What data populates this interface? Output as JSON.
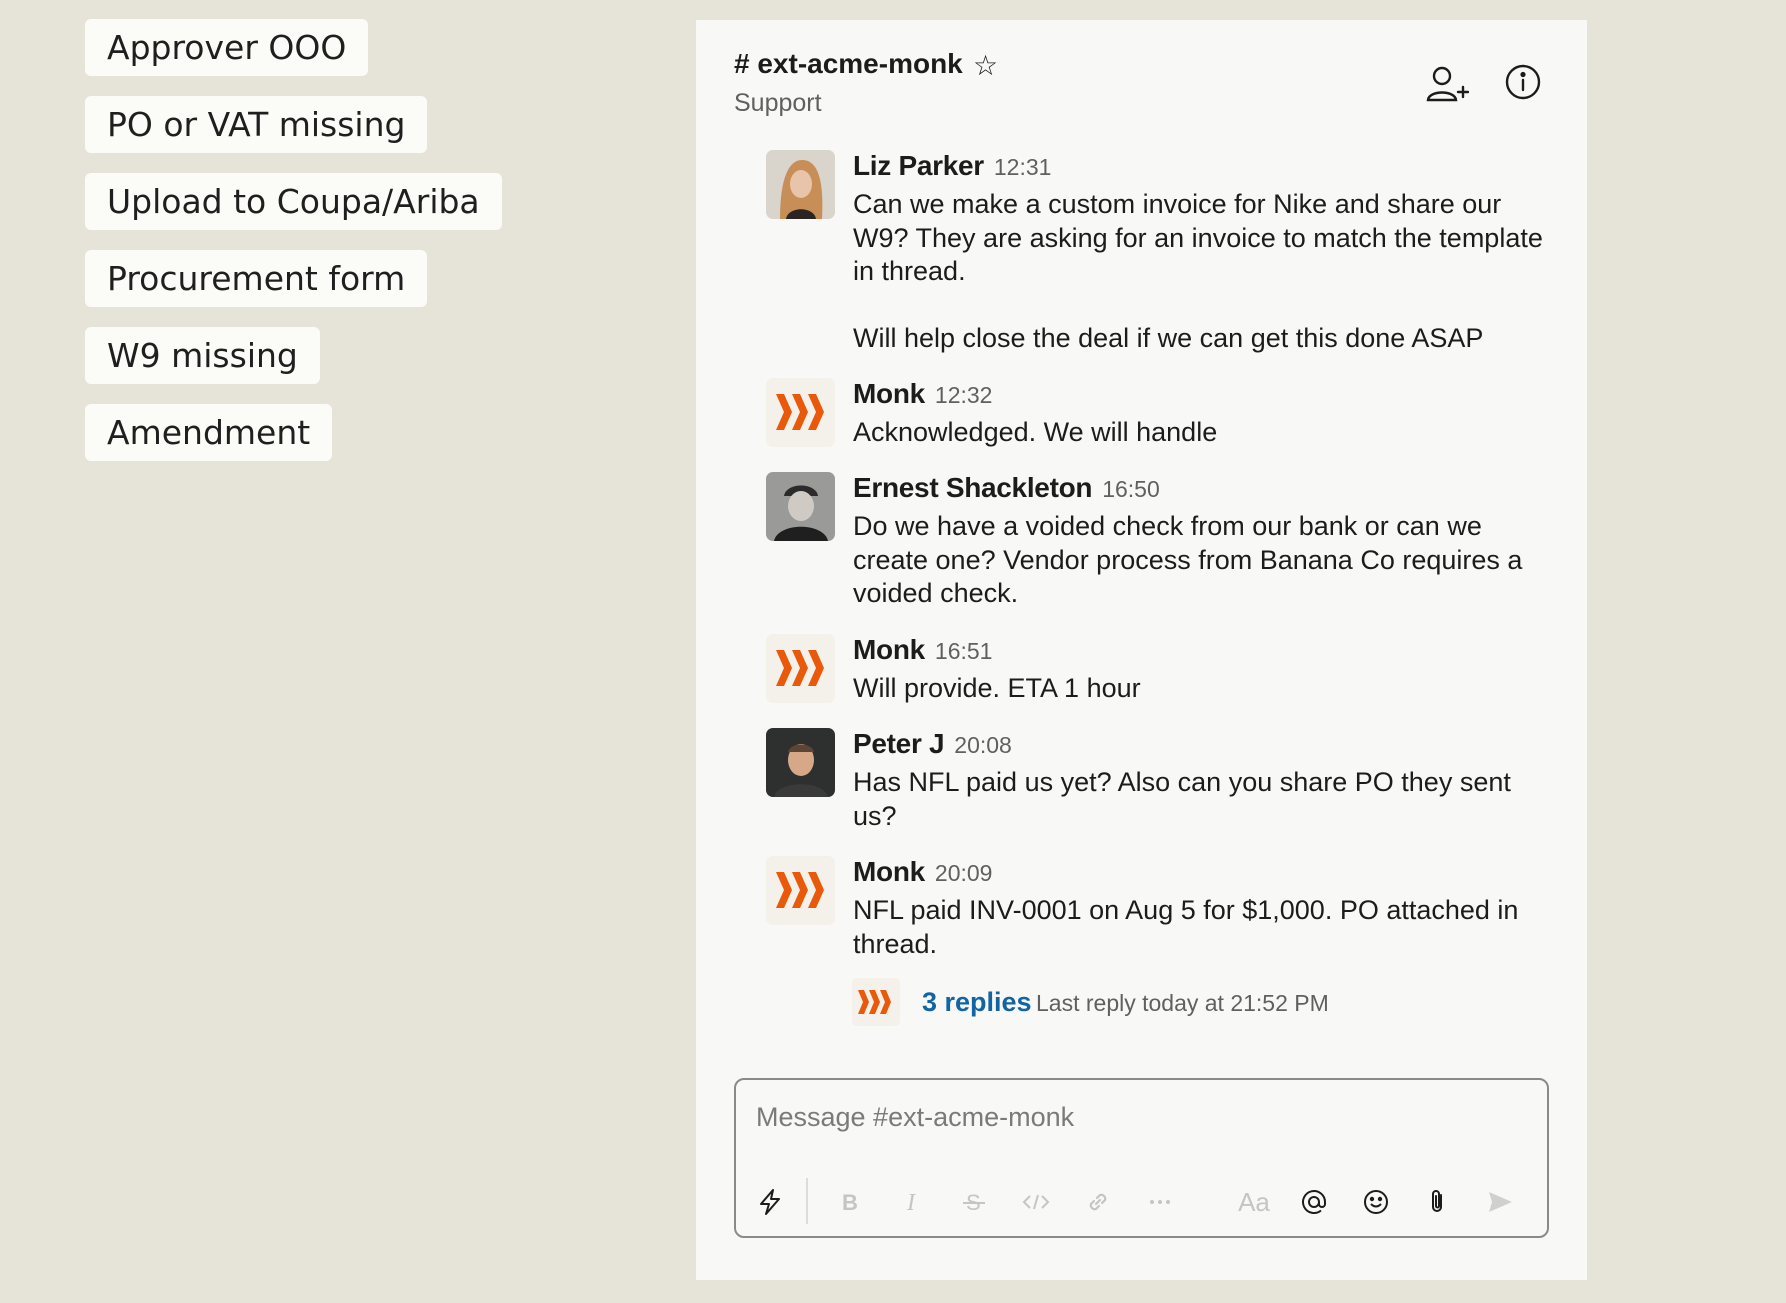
{
  "tags": [
    "Approver OOO",
    "PO or VAT missing",
    "Upload to Coupa/Ariba",
    "Procurement form",
    "W9 missing",
    "Amendment"
  ],
  "channel": {
    "name": "# ext-acme-monk",
    "topic": "Support"
  },
  "messages": [
    {
      "author": "Liz Parker",
      "time": "12:31",
      "text": "Can we make a custom invoice for Nike and share our W9? They are asking for an invoice to match the template in thread.\n\nWill help close the deal if we can get this done ASAP",
      "avatar": "woman-portrait"
    },
    {
      "author": "Monk",
      "time": "12:32",
      "text": "Acknowledged. We will handle",
      "avatar": "monk-logo"
    },
    {
      "author": "Ernest Shackleton",
      "time": "16:50",
      "text": "Do we have a voided check from our bank or can we create one? Vendor process from Banana Co requires a voided check.",
      "avatar": "man-bw-portrait"
    },
    {
      "author": "Monk",
      "time": "16:51",
      "text": "Will provide. ETA 1 hour",
      "avatar": "monk-logo"
    },
    {
      "author": "Peter  J",
      "time": "20:08",
      "text": "Has NFL paid us yet? Also can you share PO they sent us?",
      "avatar": "man-portrait"
    },
    {
      "author": "Monk",
      "time": "20:09",
      "text": "NFL paid INV-0001 on Aug 5 for $1,000. PO attached in thread.",
      "avatar": "monk-logo"
    }
  ],
  "thread": {
    "replies": "3 replies",
    "last_reply": "Last reply today at 21:52 PM"
  },
  "composer": {
    "placeholder": "Message #ext-acme-monk",
    "aa_label": "Aa"
  },
  "colors": {
    "background": "#e6e3d9",
    "panel": "#f8f8f6",
    "monk_orange": "#e8590c",
    "link_blue": "#1264a3"
  }
}
